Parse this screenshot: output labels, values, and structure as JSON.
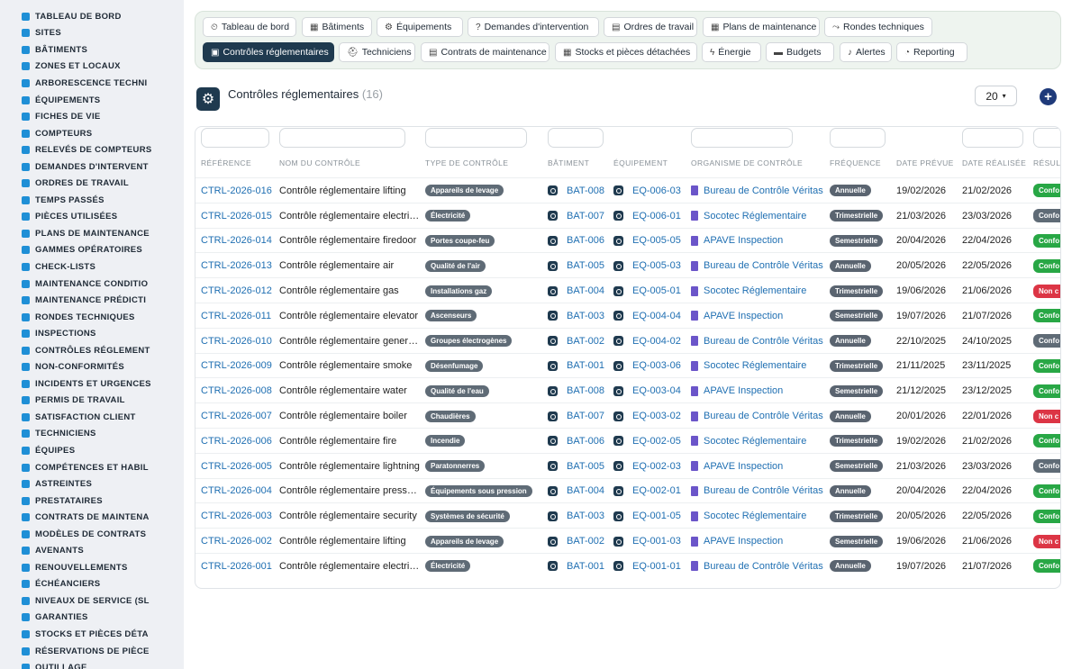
{
  "sidebar": {
    "items": [
      {
        "label": "TABLEAU DE BORD",
        "icon": "dashboard-icon"
      },
      {
        "label": "SITES",
        "icon": "map-pin-icon"
      },
      {
        "label": "BÂTIMENTS",
        "icon": "building-icon"
      },
      {
        "label": "ZONES ET LOCAUX",
        "icon": "layers-icon"
      },
      {
        "label": "ARBORESCENCE TECHNI",
        "icon": "sitemap-icon"
      },
      {
        "label": "ÉQUIPEMENTS",
        "icon": "cogs-icon"
      },
      {
        "label": "FICHES DE VIE",
        "icon": "history-icon"
      },
      {
        "label": "COMPTEURS",
        "icon": "gauge-icon"
      },
      {
        "label": "RELEVÉS DE COMPTEURS",
        "icon": "chart-icon"
      },
      {
        "label": "DEMANDES D'INTERVENT",
        "icon": "question-icon"
      },
      {
        "label": "ORDRES DE TRAVAIL",
        "icon": "clipboard-icon"
      },
      {
        "label": "TEMPS PASSÉS",
        "icon": "clock-icon"
      },
      {
        "label": "PIÈCES UTILISÉES",
        "icon": "boxes-icon"
      },
      {
        "label": "PLANS DE MAINTENANCE",
        "icon": "calendar-icon"
      },
      {
        "label": "GAMMES OPÉRATOIRES",
        "icon": "list-icon"
      },
      {
        "label": "CHECK-LISTS",
        "icon": "checklist-icon"
      },
      {
        "label": "MAINTENANCE CONDITIO",
        "icon": "thermometer-icon"
      },
      {
        "label": "MAINTENANCE PRÉDICTI",
        "icon": "trend-icon"
      },
      {
        "label": "RONDES TECHNIQUES",
        "icon": "route-icon"
      },
      {
        "label": "INSPECTIONS",
        "icon": "search-icon"
      },
      {
        "label": "CONTRÔLES RÉGLEMENT",
        "icon": "clipboard-check-icon"
      },
      {
        "label": "NON-CONFORMITÉS",
        "icon": "alert-circle-icon"
      },
      {
        "label": "INCIDENTS ET URGENCES",
        "icon": "warning-icon"
      },
      {
        "label": "PERMIS DE TRAVAIL",
        "icon": "file-signature-icon"
      },
      {
        "label": "SATISFACTION CLIENT",
        "icon": "smile-icon"
      },
      {
        "label": "TECHNICIENS",
        "icon": "hard-hat-icon"
      },
      {
        "label": "ÉQUIPES",
        "icon": "users-icon"
      },
      {
        "label": "COMPÉTENCES ET HABIL",
        "icon": "certificate-icon"
      },
      {
        "label": "ASTREINTES",
        "icon": "phone-icon"
      },
      {
        "label": "PRESTATAIRES",
        "icon": "handshake-icon"
      },
      {
        "label": "CONTRATS DE MAINTENA",
        "icon": "file-contract-icon"
      },
      {
        "label": "MODÈLES DE CONTRATS",
        "icon": "file-icon"
      },
      {
        "label": "AVENANTS",
        "icon": "file-edit-icon"
      },
      {
        "label": "RENOUVELLEMENTS",
        "icon": "refresh-icon"
      },
      {
        "label": "ÉCHÉANCIERS",
        "icon": "calendar-days-icon"
      },
      {
        "label": "NIVEAUX DE SERVICE (SL",
        "icon": "gauge-high-icon"
      },
      {
        "label": "GARANTIES",
        "icon": "shield-icon"
      },
      {
        "label": "STOCKS ET PIÈCES DÉTA",
        "icon": "warehouse-icon"
      },
      {
        "label": "RÉSERVATIONS DE PIÈCE",
        "icon": "bookmark-icon"
      },
      {
        "label": "OUTILLAGE",
        "icon": "tools-icon"
      }
    ]
  },
  "tabs": [
    {
      "label": "Tableau de bord",
      "icon": "⏲"
    },
    {
      "label": "Bâtiments",
      "icon": "▦"
    },
    {
      "label": "Équipements",
      "icon": "⚙"
    },
    {
      "label": "Demandes d'intervention",
      "icon": "?"
    },
    {
      "label": "Ordres de travail",
      "icon": "▤"
    },
    {
      "label": "Plans de maintenance",
      "icon": "▦"
    },
    {
      "label": "Rondes techniques",
      "icon": "⤳"
    },
    {
      "label": "Contrôles réglementaires",
      "icon": "▣",
      "active": true
    },
    {
      "label": "Techniciens",
      "icon": "⛑"
    },
    {
      "label": "Contrats de maintenance",
      "icon": "▤"
    },
    {
      "label": "Stocks et pièces détachées",
      "icon": "▦"
    },
    {
      "label": "Énergie",
      "icon": "ϟ"
    },
    {
      "label": "Budgets",
      "icon": "▬"
    },
    {
      "label": "Alertes",
      "icon": "♪"
    },
    {
      "label": "Reporting",
      "icon": "◔"
    }
  ],
  "page": {
    "title": "Contrôles réglementaires",
    "count": "(16)",
    "per_page": "20",
    "add_label": "+"
  },
  "columns": [
    "RÉFÉRENCE",
    "NOM DU CONTRÔLE",
    "TYPE DE CONTRÔLE",
    "BÂTIMENT",
    "ÉQUIPEMENT",
    "ORGANISME DE CONTRÔLE",
    "FRÉQUENCE",
    "DATE PRÉVUE",
    "DATE RÉALISÉE",
    "RÉSULT"
  ],
  "colors": {
    "conforme": "#28a745",
    "non_conforme": "#dc3545",
    "neutral": "#5f6b76",
    "link": "#1f6fb2",
    "active_tab": "#1f3a4f"
  },
  "rows": [
    {
      "ref": "CTRL-2026-016",
      "name": "Contrôle réglementaire lifting",
      "type": "Appareils de levage",
      "bat": "BAT-008",
      "eq": "EQ-006-03",
      "org": "Bureau de Contrôle Véritas",
      "freq": "Annuelle",
      "prev": "19/02/2026",
      "real": "21/02/2026",
      "res": "Confo",
      "res_status": "conforme"
    },
    {
      "ref": "CTRL-2026-015",
      "name": "Contrôle réglementaire electri…",
      "type": "Électricité",
      "bat": "BAT-007",
      "eq": "EQ-006-01",
      "org": "Socotec Réglementaire",
      "freq": "Trimestrielle",
      "prev": "21/03/2026",
      "real": "23/03/2026",
      "res": "Confo",
      "res_status": "neutral"
    },
    {
      "ref": "CTRL-2026-014",
      "name": "Contrôle réglementaire firedoor",
      "type": "Portes coupe-feu",
      "bat": "BAT-006",
      "eq": "EQ-005-05",
      "org": "APAVE Inspection",
      "freq": "Semestrielle",
      "prev": "20/04/2026",
      "real": "22/04/2026",
      "res": "Confo",
      "res_status": "conforme"
    },
    {
      "ref": "CTRL-2026-013",
      "name": "Contrôle réglementaire air",
      "type": "Qualité de l'air",
      "bat": "BAT-005",
      "eq": "EQ-005-03",
      "org": "Bureau de Contrôle Véritas",
      "freq": "Annuelle",
      "prev": "20/05/2026",
      "real": "22/05/2026",
      "res": "Confo",
      "res_status": "conforme"
    },
    {
      "ref": "CTRL-2026-012",
      "name": "Contrôle réglementaire gas",
      "type": "Installations gaz",
      "bat": "BAT-004",
      "eq": "EQ-005-01",
      "org": "Socotec Réglementaire",
      "freq": "Trimestrielle",
      "prev": "19/06/2026",
      "real": "21/06/2026",
      "res": "Non c",
      "res_status": "non_conforme"
    },
    {
      "ref": "CTRL-2026-011",
      "name": "Contrôle réglementaire elevator",
      "type": "Ascenseurs",
      "bat": "BAT-003",
      "eq": "EQ-004-04",
      "org": "APAVE Inspection",
      "freq": "Semestrielle",
      "prev": "19/07/2026",
      "real": "21/07/2026",
      "res": "Confo",
      "res_status": "conforme"
    },
    {
      "ref": "CTRL-2026-010",
      "name": "Contrôle réglementaire gener…",
      "type": "Groupes électrogènes",
      "bat": "BAT-002",
      "eq": "EQ-004-02",
      "org": "Bureau de Contrôle Véritas",
      "freq": "Annuelle",
      "prev": "22/10/2025",
      "real": "24/10/2025",
      "res": "Confo",
      "res_status": "neutral"
    },
    {
      "ref": "CTRL-2026-009",
      "name": "Contrôle réglementaire smoke",
      "type": "Désenfumage",
      "bat": "BAT-001",
      "eq": "EQ-003-06",
      "org": "Socotec Réglementaire",
      "freq": "Trimestrielle",
      "prev": "21/11/2025",
      "real": "23/11/2025",
      "res": "Confo",
      "res_status": "conforme"
    },
    {
      "ref": "CTRL-2026-008",
      "name": "Contrôle réglementaire water",
      "type": "Qualité de l'eau",
      "bat": "BAT-008",
      "eq": "EQ-003-04",
      "org": "APAVE Inspection",
      "freq": "Semestrielle",
      "prev": "21/12/2025",
      "real": "23/12/2025",
      "res": "Confo",
      "res_status": "conforme"
    },
    {
      "ref": "CTRL-2026-007",
      "name": "Contrôle réglementaire boiler",
      "type": "Chaudières",
      "bat": "BAT-007",
      "eq": "EQ-003-02",
      "org": "Bureau de Contrôle Véritas",
      "freq": "Annuelle",
      "prev": "20/01/2026",
      "real": "22/01/2026",
      "res": "Non c",
      "res_status": "non_conforme"
    },
    {
      "ref": "CTRL-2026-006",
      "name": "Contrôle réglementaire fire",
      "type": "Incendie",
      "bat": "BAT-006",
      "eq": "EQ-002-05",
      "org": "Socotec Réglementaire",
      "freq": "Trimestrielle",
      "prev": "19/02/2026",
      "real": "21/02/2026",
      "res": "Confo",
      "res_status": "conforme"
    },
    {
      "ref": "CTRL-2026-005",
      "name": "Contrôle réglementaire lightning",
      "type": "Paratonnerres",
      "bat": "BAT-005",
      "eq": "EQ-002-03",
      "org": "APAVE Inspection",
      "freq": "Semestrielle",
      "prev": "21/03/2026",
      "real": "23/03/2026",
      "res": "Confo",
      "res_status": "neutral"
    },
    {
      "ref": "CTRL-2026-004",
      "name": "Contrôle réglementaire press…",
      "type": "Équipements sous pression",
      "bat": "BAT-004",
      "eq": "EQ-002-01",
      "org": "Bureau de Contrôle Véritas",
      "freq": "Annuelle",
      "prev": "20/04/2026",
      "real": "22/04/2026",
      "res": "Confo",
      "res_status": "conforme"
    },
    {
      "ref": "CTRL-2026-003",
      "name": "Contrôle réglementaire security",
      "type": "Systèmes de sécurité",
      "bat": "BAT-003",
      "eq": "EQ-001-05",
      "org": "Socotec Réglementaire",
      "freq": "Trimestrielle",
      "prev": "20/05/2026",
      "real": "22/05/2026",
      "res": "Confo",
      "res_status": "conforme"
    },
    {
      "ref": "CTRL-2026-002",
      "name": "Contrôle réglementaire lifting",
      "type": "Appareils de levage",
      "bat": "BAT-002",
      "eq": "EQ-001-03",
      "org": "APAVE Inspection",
      "freq": "Semestrielle",
      "prev": "19/06/2026",
      "real": "21/06/2026",
      "res": "Non c",
      "res_status": "non_conforme"
    },
    {
      "ref": "CTRL-2026-001",
      "name": "Contrôle réglementaire electri…",
      "type": "Électricité",
      "bat": "BAT-001",
      "eq": "EQ-001-01",
      "org": "Bureau de Contrôle Véritas",
      "freq": "Annuelle",
      "prev": "19/07/2026",
      "real": "21/07/2026",
      "res": "Confo",
      "res_status": "conforme"
    }
  ]
}
